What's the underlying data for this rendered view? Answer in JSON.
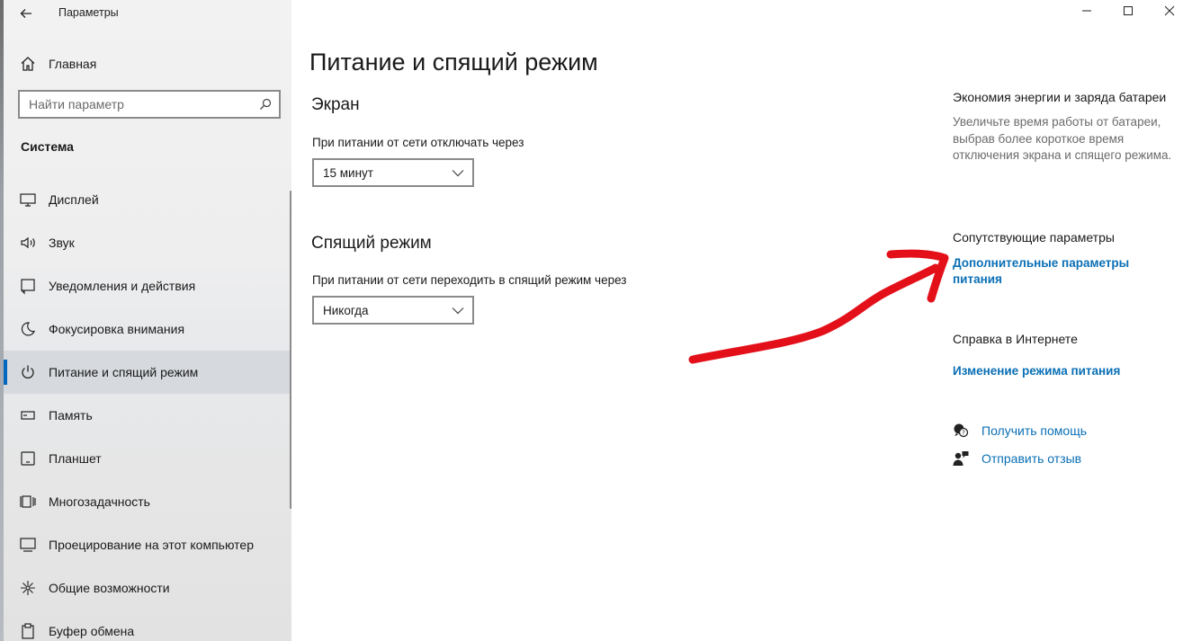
{
  "app": {
    "title": "Параметры"
  },
  "window_controls": {
    "minimize": "—",
    "maximize": "☐",
    "close": "✕"
  },
  "sidebar": {
    "home_label": "Главная",
    "search_placeholder": "Найти параметр",
    "section_title": "Система",
    "items": [
      {
        "label": "Дисплей",
        "icon": "monitor-icon"
      },
      {
        "label": "Звук",
        "icon": "speaker-icon"
      },
      {
        "label": "Уведомления и действия",
        "icon": "notification-icon"
      },
      {
        "label": "Фокусировка внимания",
        "icon": "moon-icon"
      },
      {
        "label": "Питание и спящий режим",
        "icon": "power-icon",
        "active": true
      },
      {
        "label": "Память",
        "icon": "storage-icon"
      },
      {
        "label": "Планшет",
        "icon": "tablet-icon"
      },
      {
        "label": "Многозадачность",
        "icon": "multitasking-icon"
      },
      {
        "label": "Проецирование на этот компьютер",
        "icon": "projection-icon"
      },
      {
        "label": "Общие возможности",
        "icon": "shared-experiences-icon"
      },
      {
        "label": "Буфер обмена",
        "icon": "clipboard-icon"
      }
    ]
  },
  "main": {
    "title": "Питание и спящий режим",
    "screen": {
      "heading": "Экран",
      "label": "При питании от сети отключать через",
      "value": "15 минут"
    },
    "sleep": {
      "heading": "Спящий режим",
      "label": "При питании от сети переходить в спящий режим через",
      "value": "Никогда"
    }
  },
  "side": {
    "battery_heading": "Экономия энергии и заряда батареи",
    "battery_text": "Увеличьте время работы от батареи, выбрав более короткое время отключения экрана и спящего режима.",
    "related_heading": "Сопутствующие параметры",
    "related_link_line1": "Дополнительные параметры",
    "related_link_line2": "питания",
    "web_help_heading": "Справка в Интернете",
    "web_help_link": "Изменение режима питания",
    "get_help": "Получить помощь",
    "feedback": "Отправить отзыв"
  },
  "colors": {
    "accent": "#0067c0",
    "link": "#0a6fb5",
    "annotation_arrow": "#e3101a"
  }
}
